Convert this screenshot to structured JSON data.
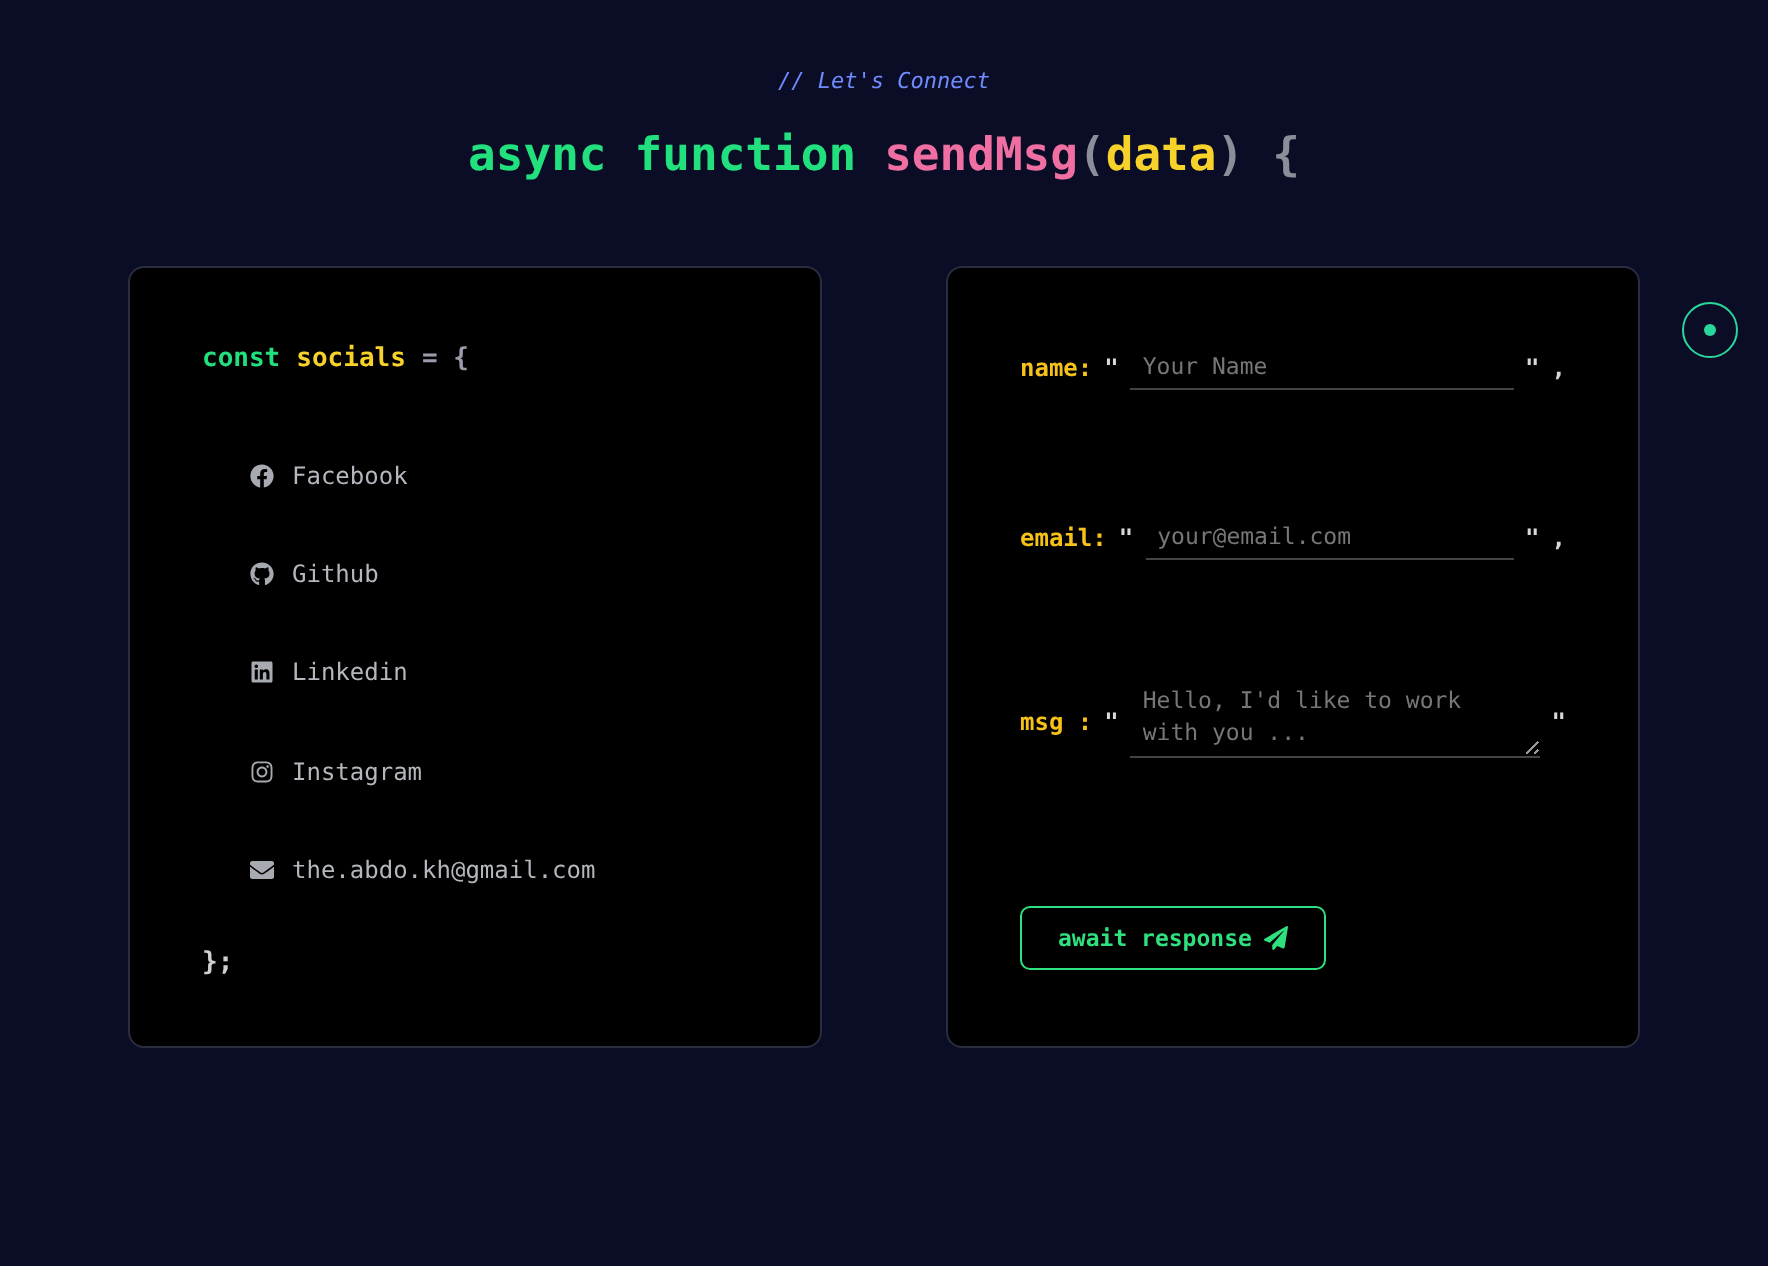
{
  "comment": "// Let's Connect",
  "heading": [
    {
      "text": "async",
      "kind": "keyword"
    },
    {
      "text": "function",
      "kind": "keyword"
    },
    {
      "text": "sendMsg",
      "kind": "name"
    },
    {
      "text": "(",
      "kind": "punct"
    },
    {
      "text": "data",
      "kind": "param"
    },
    {
      "text": ")",
      "kind": "punct"
    },
    {
      "text": "{",
      "kind": "punct"
    }
  ],
  "socials": {
    "keyword": "const",
    "name": "socials",
    "assign": "= {",
    "close": "};",
    "items": [
      {
        "label": "Facebook",
        "kind": "facebook"
      },
      {
        "label": "Github",
        "kind": "github"
      },
      {
        "label": "Linkedin",
        "kind": "linkedin"
      },
      {
        "label": "Instagram",
        "kind": "instagram"
      },
      {
        "label": "the.abdo.kh@gmail.com",
        "kind": "email"
      }
    ]
  },
  "form": {
    "fields": [
      {
        "label": "name:",
        "open": "\"",
        "placeholder": "Your Name",
        "close": "\"",
        "comma": ",",
        "kind": "input"
      },
      {
        "label": "email:",
        "open": "\"",
        "placeholder": "your@email.com",
        "close": "\"",
        "comma": ",",
        "kind": "input"
      },
      {
        "label": "msg :",
        "open": "\"",
        "placeholder": "Hello, I'd like to work with you ...",
        "close": "\"",
        "kind": "textarea"
      }
    ],
    "button": "await response"
  }
}
